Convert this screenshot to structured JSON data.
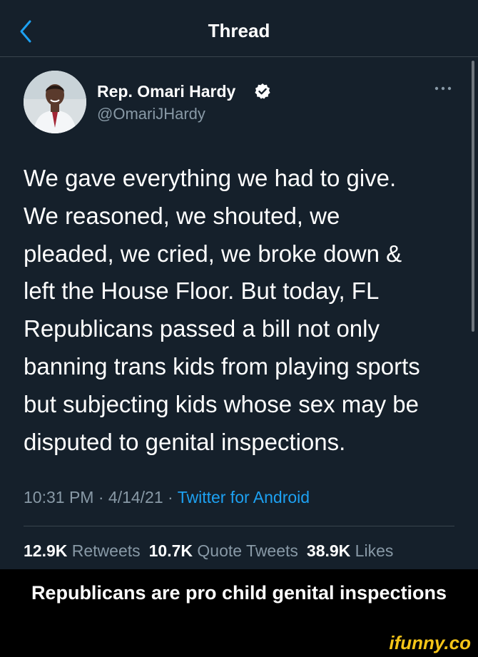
{
  "nav": {
    "title": "Thread"
  },
  "author": {
    "name": "Rep. Omari Hardy",
    "handle": "@OmariJHardy"
  },
  "tweet": {
    "text": "We gave everything we had to give.\nWe reasoned, we shouted, we\npleaded, we cried, we broke down &\nleft the House Floor. But today, FL\nRepublicans passed a bill not only\nbanning trans kids from playing sports\nbut subjecting kids whose sex may be\ndisputed to genital inspections.",
    "time": "10:31 PM",
    "date": "4/14/21",
    "source": "Twitter for Android"
  },
  "stats": {
    "retweets_count": "12.9K",
    "retweets_label": "Retweets",
    "quotes_count": "10.7K",
    "quotes_label": "Quote Tweets",
    "likes_count": "38.9K",
    "likes_label": "Likes"
  },
  "caption": {
    "text": "Republicans are pro child genital inspections"
  },
  "watermark": {
    "text": "ifunny.co"
  },
  "colors": {
    "background": "#15202b",
    "accent": "#1da1f2",
    "secondary_text": "#8899a6",
    "divider": "#38444d"
  },
  "icons": {
    "back": "chevron-left-icon",
    "verified": "verified-badge-icon",
    "more": "more-dots-icon"
  }
}
